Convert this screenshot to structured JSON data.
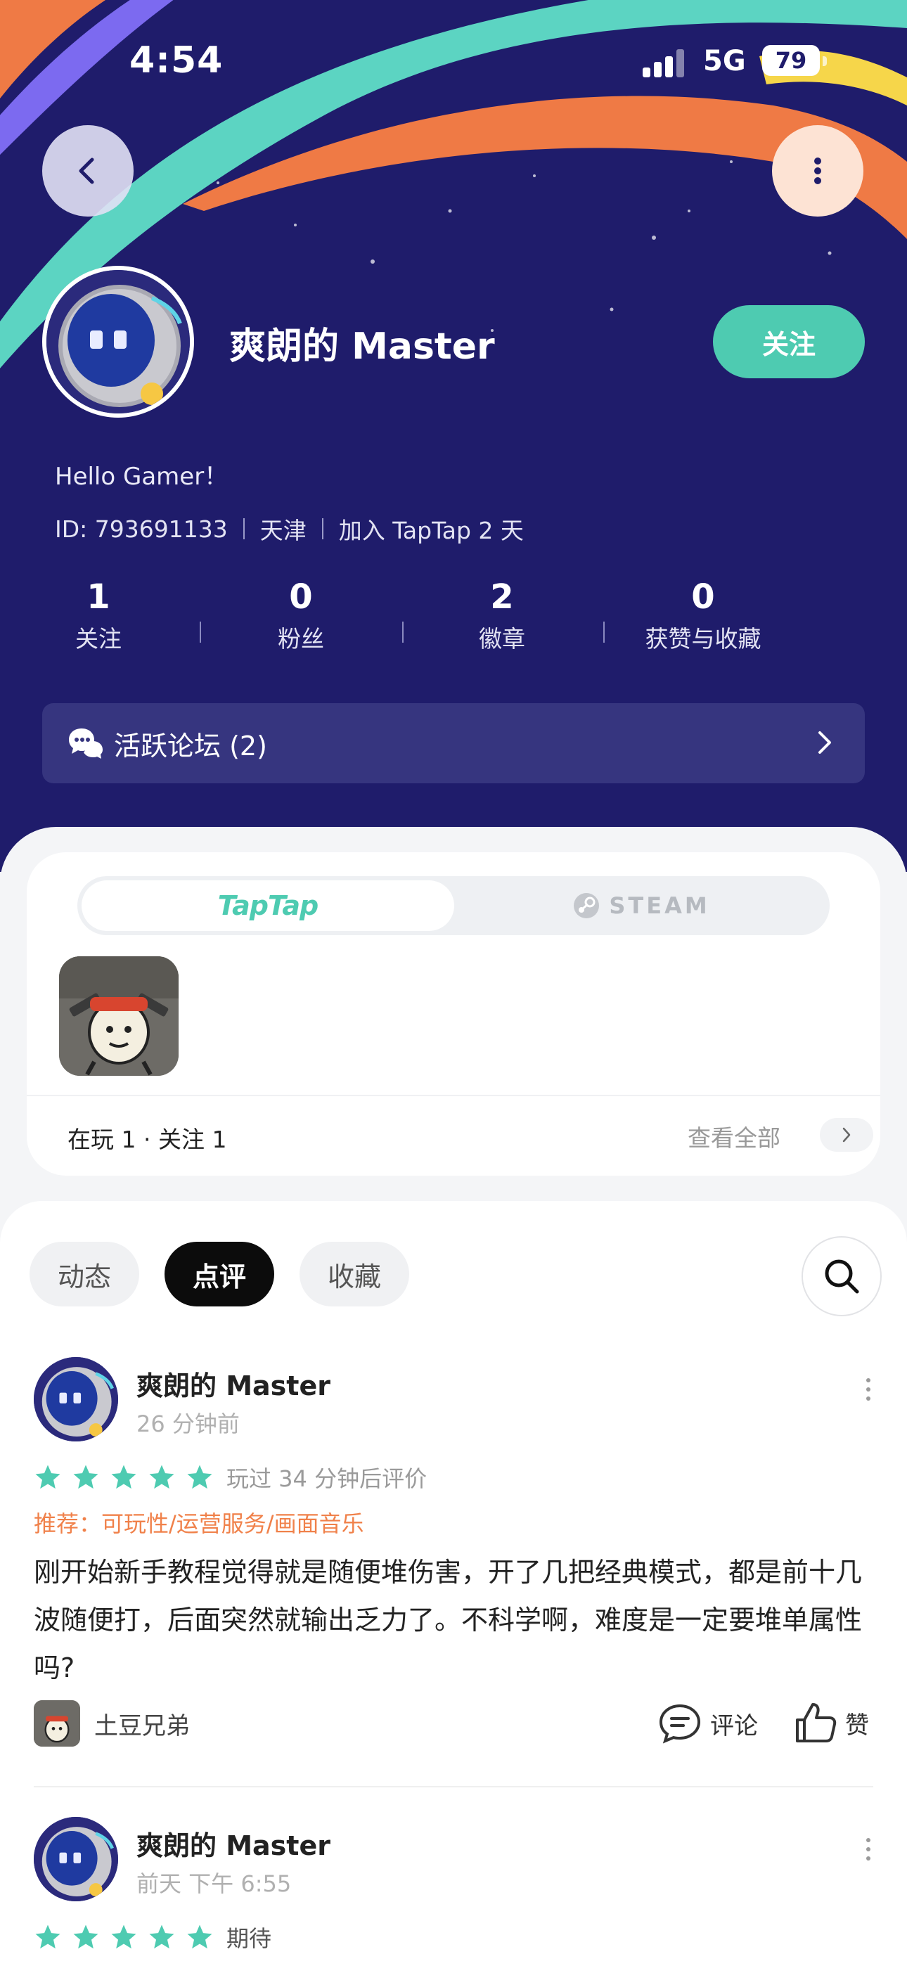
{
  "status_bar": {
    "time": "4:54",
    "network": "5G",
    "battery": "79"
  },
  "profile": {
    "name": "爽朗的 Master",
    "follow_label": "关注",
    "bio": "Hello Gamer！",
    "meta": [
      "ID: 793691133",
      "天津",
      "加入 TapTap 2 天"
    ],
    "stats": [
      {
        "value": "1",
        "label": "关注"
      },
      {
        "value": "0",
        "label": "粉丝"
      },
      {
        "value": "2",
        "label": "徽章"
      },
      {
        "value": "0",
        "label": "获赞与收藏"
      }
    ],
    "forum_label": "活跃论坛 (2)"
  },
  "games": {
    "tabs": [
      "TapTap",
      "STEAM"
    ],
    "active_tab": "TapTap",
    "summary": "在玩 1 · 关注 1",
    "view_all": "查看全部"
  },
  "feed": {
    "tabs": [
      "动态",
      "点评",
      "收藏"
    ],
    "active_tab": "点评",
    "posts": [
      {
        "author": "爽朗的 Master",
        "time": "26 分钟前",
        "rating": 5,
        "note": "玩过 34 分钟后评价",
        "recommend": "推荐：可玩性/运营服务/画面音乐",
        "content": "刚开始新手教程觉得就是随便堆伤害，开了几把经典模式，都是前十几波随便打，后面突然就输出乏力了。不科学啊，难度是一定要堆单属性吗?",
        "game": "土豆兄弟",
        "comment_label": "评论",
        "like_label": "赞"
      },
      {
        "author": "爽朗的 Master",
        "time": "前天 下午 6:55",
        "rating": 5,
        "note": "期待"
      }
    ]
  },
  "colors": {
    "header_bg": "#1f1c6b",
    "accent_teal": "#4ecbb1",
    "recommend_orange": "#f0814a",
    "star": "#4ecbb1"
  }
}
